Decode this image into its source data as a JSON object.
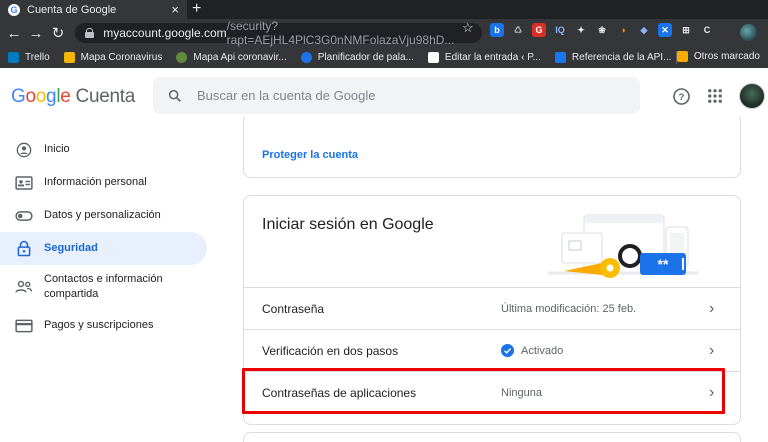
{
  "browser": {
    "tab_title": "Cuenta de Google",
    "new_tab": "+",
    "url_host": "myaccount.google.com",
    "url_path": "/security?rapt=AEjHL4PlC3G0nNMFolazaVju98hD...",
    "bookmarks": [
      {
        "label": "Trello",
        "color": "#0079bf"
      },
      {
        "label": "Mapa Coronavirus",
        "color": "#f4b400"
      },
      {
        "label": "Mapa Api coronavir...",
        "color": "#5f8b3a"
      },
      {
        "label": "Planificador de pala...",
        "color": "#1a73e8"
      },
      {
        "label": "Editar la entrada ‹ P...",
        "color": "#ffffff"
      },
      {
        "label": "Referencia de la API...",
        "color": "#1877f2"
      }
    ],
    "other_bookmarks": "Otros marcado"
  },
  "header": {
    "logo_parts": [
      "G",
      "o",
      "o",
      "g",
      "l",
      "e"
    ],
    "product": "Cuenta",
    "search_placeholder": "Buscar en la cuenta de Google"
  },
  "sidebar": {
    "items": [
      {
        "label": "Inicio",
        "icon": "home-icon"
      },
      {
        "label": "Información personal",
        "icon": "id-card-icon"
      },
      {
        "label": "Datos y personalización",
        "icon": "toggle-icon"
      },
      {
        "label": "Seguridad",
        "icon": "lock-icon",
        "active": true
      },
      {
        "label": "Contactos e información compartida",
        "icon": "people-icon"
      },
      {
        "label": "Pagos y suscripciones",
        "icon": "card-icon"
      }
    ]
  },
  "security": {
    "protect_link": "Proteger la cuenta",
    "signin_title": "Iniciar sesión en Google",
    "rows": [
      {
        "label": "Contraseña",
        "value": "Última modificación: 25 feb."
      },
      {
        "label": "Verificación en dos pasos",
        "value": "Activado",
        "status": "on"
      },
      {
        "label": "Contraseñas de aplicaciones",
        "value": "Ninguna"
      }
    ],
    "password_mask": "**"
  },
  "colors": {
    "accent": "#1a73e8",
    "active_bg": "#e8f0fe",
    "highlight": "#e00000"
  }
}
